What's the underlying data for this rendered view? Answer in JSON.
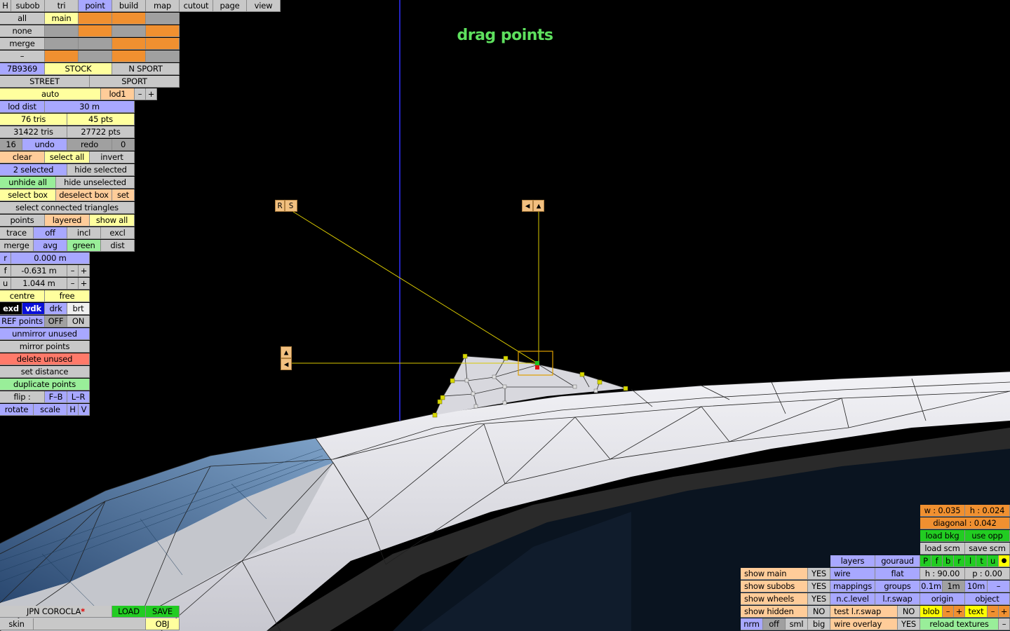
{
  "viewport_title": "drag points",
  "gizmo": {
    "rotate_label": "R",
    "scale_label": "S",
    "left_arrow": "◀",
    "up_arrow": "▲"
  },
  "top_menu": {
    "h": "H",
    "subob": "subob",
    "tri": "tri",
    "point": "point",
    "build": "build",
    "map": "map",
    "cutout": "cutout",
    "page": "page",
    "view": "view"
  },
  "select_modes": {
    "all": "all",
    "main": "main",
    "none": "none",
    "merge": "merge",
    "dash": "–"
  },
  "lod_row": {
    "id": "7B9369",
    "stock": "STOCK",
    "n_sport": "N SPORT"
  },
  "street_row": {
    "street": "STREET",
    "sport": "SPORT"
  },
  "auto_row": {
    "auto": "auto",
    "lod": "lod1",
    "minus": "–",
    "plus": "+"
  },
  "stats": {
    "lod_dist_label": "lod dist",
    "lod_dist_value": "30 m",
    "tris": "76 tris",
    "pts": "45 pts",
    "total_tris": "31422 tris",
    "total_pts": "27722 pts",
    "undo_count": "16",
    "undo": "undo",
    "redo": "redo",
    "redo_count": "0"
  },
  "selection": {
    "clear": "clear",
    "select_all": "select all",
    "invert": "invert",
    "selected_count": "2 selected",
    "hide_selected": "hide selected",
    "unhide_all": "unhide all",
    "hide_unselected": "hide unselected",
    "select_box": "select box",
    "deselect_box": "deselect box",
    "set": "set",
    "select_connected": "select connected triangles"
  },
  "points_row": {
    "points": "points",
    "layered": "layered",
    "show_all": "show all"
  },
  "trace_row": {
    "trace": "trace",
    "off": "off",
    "incl": "incl",
    "excl": "excl"
  },
  "merge_row": {
    "merge": "merge",
    "avg": "avg",
    "green": "green",
    "dist": "dist"
  },
  "coords": {
    "r_label": "r",
    "r_value": "0.000 m",
    "f_label": "f",
    "f_value": "-0.631 m",
    "u_label": "u",
    "u_value": "1.044 m",
    "minus": "–",
    "plus": "+"
  },
  "pivot": {
    "centre": "centre",
    "free": "free"
  },
  "render": {
    "exd": "exd",
    "vdk": "vdk",
    "drk": "drk",
    "brt": "brt"
  },
  "ref_points": {
    "label": "REF points",
    "off": "OFF",
    "on": "ON"
  },
  "actions": {
    "unmirror_unused": "unmirror unused",
    "mirror_points": "mirror points",
    "delete_unused": "delete unused",
    "set_distance": "set distance",
    "duplicate_points": "duplicate points"
  },
  "flip": {
    "label": "flip :",
    "fb": "F–B",
    "lr": "L–R"
  },
  "transform": {
    "rotate": "rotate",
    "scale": "scale",
    "h": "H",
    "v": "V"
  },
  "file": {
    "car_name": "JPN COROCLA",
    "modified_marker": "*",
    "load": "LOAD",
    "save": "SAVE",
    "skin": "skin",
    "obj": "OBJ"
  },
  "dims": {
    "w": "w : 0.035",
    "h": "h : 0.024",
    "diagonal": "diagonal : 0.042",
    "load_bkg": "load bkg",
    "use_opp": "use opp",
    "load_scm": "load scm",
    "save_scm": "save scm"
  },
  "view_opts": {
    "layers": "layers",
    "gouraud": "gouraud",
    "show_main": "show main",
    "yes1": "YES",
    "wire": "wire",
    "flat": "flat",
    "show_subobs": "show subobs",
    "yes2": "YES",
    "mappings": "mappings",
    "groups": "groups",
    "show_wheels": "show wheels",
    "yes3": "YES",
    "nc_level": "n.c.level",
    "lr_swap": "l.r.swap",
    "show_hidden": "show hidden",
    "no1": "NO",
    "test_lr_swap": "test l.r.swap",
    "no2": "NO",
    "nrm": "nrm",
    "off": "off",
    "sml": "sml",
    "big": "big",
    "wire_overlay": "wire overlay",
    "yes4": "YES"
  },
  "cam": {
    "p": "P",
    "f": "f",
    "b": "b",
    "r": "r",
    "l": "l",
    "t": "t",
    "u": "u",
    "dot": "●",
    "heading": "h : 90.00",
    "pitch": "p : 0.00",
    "s01": "0.1m",
    "s1": "1m",
    "s10": "10m",
    "minus": "–",
    "origin": "origin",
    "object": "object",
    "blob": "blob",
    "text": "text",
    "plus": "+",
    "reload_textures": "reload textures"
  }
}
